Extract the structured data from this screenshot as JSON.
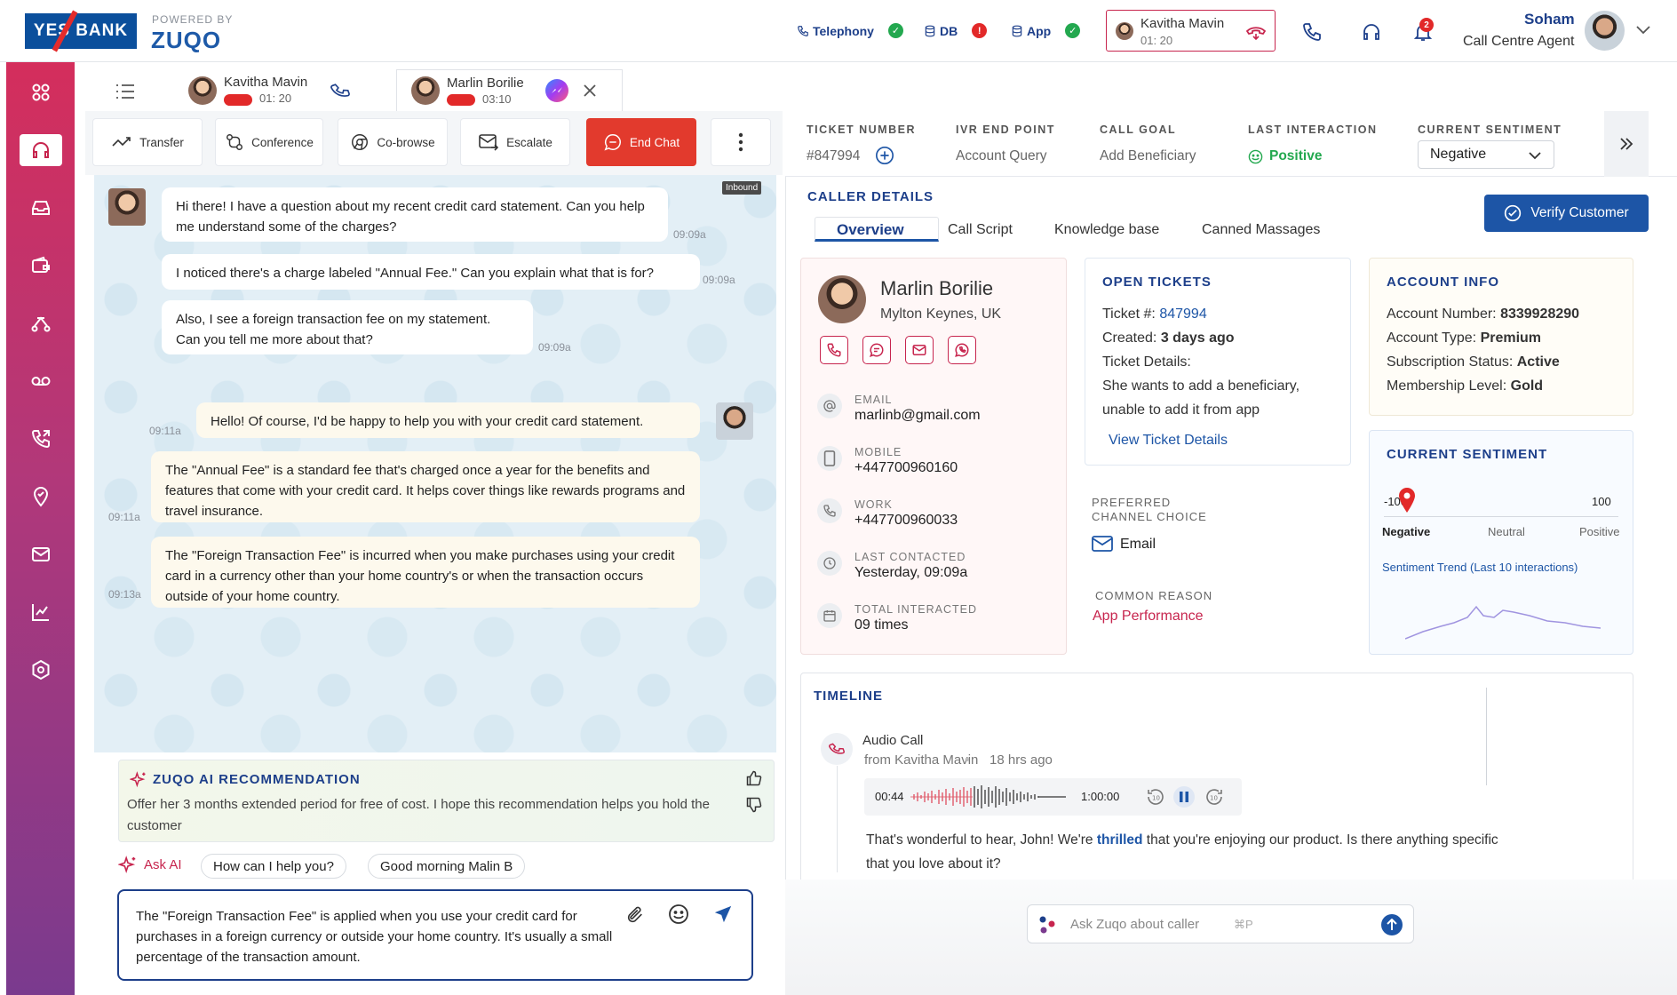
{
  "brand": {
    "logo_text": "YES BANK",
    "powered_by": "POWERED BY",
    "product": "ZUQO"
  },
  "status": [
    {
      "label": "Telephony",
      "state": "ok"
    },
    {
      "label": "DB",
      "state": "error"
    },
    {
      "label": "App",
      "state": "ok"
    }
  ],
  "active_call": {
    "name": "Kavitha Mavin",
    "timer": "01: 20"
  },
  "notifications": {
    "count": "2"
  },
  "user": {
    "name": "Soham",
    "role": "Call Centre Agent"
  },
  "tabs": [
    {
      "name": "Kavitha Mavin",
      "timer": "01: 20"
    },
    {
      "name": "Marlin Borilie",
      "timer": "03:10"
    }
  ],
  "toolbar": {
    "transfer": "Transfer",
    "conference": "Conference",
    "cobrowse": "Co-browse",
    "escalate": "Escalate",
    "end_chat": "End Chat"
  },
  "chat": {
    "inbound_tag": "Inbound",
    "messages": [
      {
        "text": "Hi there! I have a question about my recent credit card statement. Can you help me understand some of the charges?",
        "time": "09:09a"
      },
      {
        "text": "I noticed there's a charge labeled \"Annual Fee.\" Can you explain what that is for?",
        "time": "09:09a"
      },
      {
        "text": "Also, I see a foreign transaction fee on my statement. Can you tell me more about that?",
        "time": "09:09a"
      },
      {
        "text": "Hello! Of course, I'd be happy to help you with your credit card statement.",
        "time": "09:11a"
      },
      {
        "text": "The \"Annual Fee\" is a standard fee that's charged once a year for the benefits and features that come with your credit card. It helps cover things like rewards programs and travel insurance.",
        "time": "09:11a"
      },
      {
        "text": "The \"Foreign Transaction Fee\" is incurred when you make purchases using your credit card in a currency other than your home country's or when the transaction occurs outside of your home country.",
        "time": "09:13a"
      }
    ]
  },
  "ai": {
    "title": "ZUQO AI RECOMMENDATION",
    "text": "Offer her 3 months extended period for free of cost. I hope this recommendation helps you hold the customer",
    "ask_label": "Ask AI",
    "suggestions": [
      "How can I help you?",
      "Good morning Malin B"
    ]
  },
  "compose": {
    "text": "The \"Foreign Transaction Fee\" is applied when you use your credit card for purchases in a foreign currency or outside your home country. It's usually a small percentage of the transaction amount."
  },
  "ticket_bar": {
    "ticket_number_label": "TICKET NUMBER",
    "ticket_number": "#847994",
    "ivr_label": "IVR END POINT",
    "ivr": "Account Query",
    "goal_label": "CALL GOAL",
    "goal": "Add Beneficiary",
    "last_label": "LAST INTERACTION",
    "last": "Positive",
    "sentiment_label": "CURRENT SENTIMENT",
    "sentiment": "Negative"
  },
  "caller_details": {
    "title": "CALLER DETAILS",
    "tabs": [
      "Overview",
      "Call Script",
      "Knowledge base",
      "Canned Massages"
    ],
    "verify": "Verify Customer"
  },
  "caller": {
    "name": "Marlin Borilie",
    "location": "Mylton Keynes, UK",
    "email_label": "EMAIL",
    "email": "marlinb@gmail.com",
    "mobile_label": "MOBILE",
    "mobile": "+447700960160",
    "work_label": "WORK",
    "work": "+447700960033",
    "last_label": "LAST CONTACTED",
    "last": "Yesterday, 09:09a",
    "total_label": "TOTAL INTERACTED",
    "total": "09 times"
  },
  "open_tickets": {
    "title": "OPEN TICKETS",
    "ticket_label": "Ticket #:",
    "ticket": "847994",
    "created_label": "Created:",
    "created": "3 days ago",
    "details_label": "Ticket Details:",
    "details": "She wants to add a beneficiary, unable to add it from app",
    "view": "View Ticket Details"
  },
  "preferred": {
    "label1": "PREFERRED",
    "label2": "CHANNEL CHOICE",
    "value": "Email"
  },
  "common_reason": {
    "label": "COMMON REASON",
    "value": "App Performance"
  },
  "account": {
    "title": "ACCOUNT INFO",
    "number_label": "Account Number:",
    "number": "8339928290",
    "type_label": "Account Type:",
    "type": "Premium",
    "sub_label": "Subscription Status:",
    "sub": "Active",
    "level_label": "Membership Level:",
    "level": "Gold"
  },
  "sentiment": {
    "title": "CURRENT SENTIMENT",
    "min": "-100",
    "max": "100",
    "negative": "Negative",
    "neutral": "Neutral",
    "positive": "Positive",
    "trend_label": "Sentiment Trend (Last 10 interactions)",
    "value": -80
  },
  "timeline": {
    "title": "TIMELINE",
    "item_title": "Audio Call",
    "from": "from Kavitha Mavin",
    "ago": "18 hrs ago",
    "current": "00:44",
    "duration": "1:00:00",
    "transcript_a": "That's wonderful to hear, John! We're ",
    "transcript_b": "thrilled",
    "transcript_c": " that you're enjoying our product. Is there anything specific that you love about it?"
  },
  "ask_zuqo": {
    "placeholder": "Ask Zuqo about caller",
    "shortcut": "⌘P"
  },
  "colors": {
    "brand_blue": "#1d3f8a",
    "accent_red": "#c7254e",
    "end_chat": "#e23a2d",
    "positive": "#23a84f"
  }
}
